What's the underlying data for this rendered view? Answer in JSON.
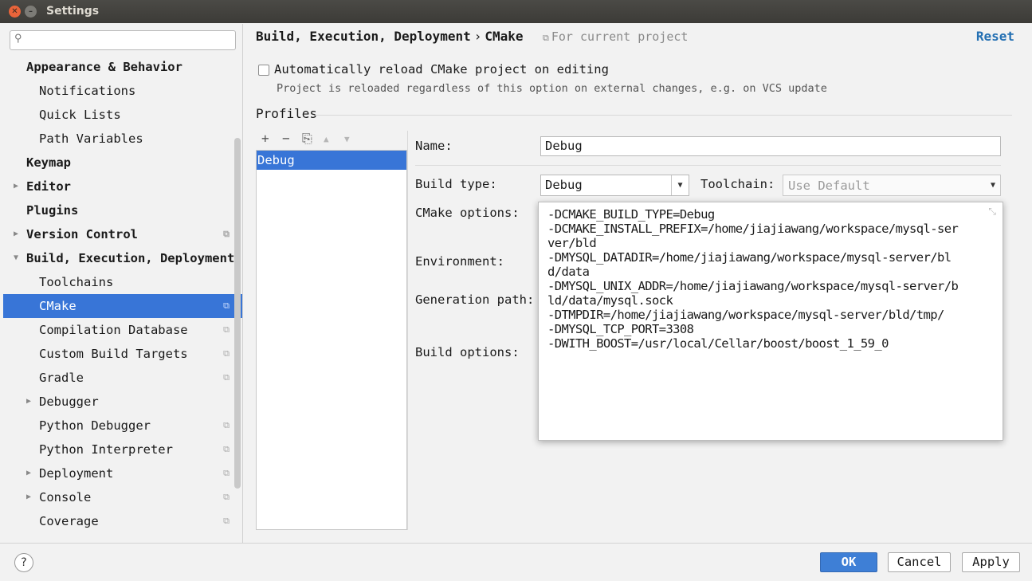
{
  "window": {
    "title": "Settings"
  },
  "sidebar": {
    "search_placeholder": "",
    "items": [
      {
        "label": "Appearance & Behavior",
        "level": 0,
        "arrow": "",
        "copy": false
      },
      {
        "label": "Notifications",
        "level": 1,
        "arrow": "",
        "copy": false
      },
      {
        "label": "Quick Lists",
        "level": 1,
        "arrow": "",
        "copy": false
      },
      {
        "label": "Path Variables",
        "level": 1,
        "arrow": "",
        "copy": false
      },
      {
        "label": "Keymap",
        "level": 0,
        "arrow": "",
        "copy": false
      },
      {
        "label": "Editor",
        "level": 0,
        "arrow": "▶",
        "copy": false
      },
      {
        "label": "Plugins",
        "level": 0,
        "arrow": "",
        "copy": false
      },
      {
        "label": "Version Control",
        "level": 0,
        "arrow": "▶",
        "copy": true
      },
      {
        "label": "Build, Execution, Deployment",
        "level": 0,
        "arrow": "▼",
        "copy": false
      },
      {
        "label": "Toolchains",
        "level": 1,
        "arrow": "",
        "copy": false
      },
      {
        "label": "CMake",
        "level": 1,
        "arrow": "",
        "copy": true,
        "selected": true
      },
      {
        "label": "Compilation Database",
        "level": 1,
        "arrow": "",
        "copy": true
      },
      {
        "label": "Custom Build Targets",
        "level": 1,
        "arrow": "",
        "copy": true
      },
      {
        "label": "Gradle",
        "level": 1,
        "arrow": "",
        "copy": true
      },
      {
        "label": "Debugger",
        "level": 1,
        "arrow": "▶",
        "copy": false
      },
      {
        "label": "Python Debugger",
        "level": 1,
        "arrow": "",
        "copy": true
      },
      {
        "label": "Python Interpreter",
        "level": 1,
        "arrow": "",
        "copy": true
      },
      {
        "label": "Deployment",
        "level": 1,
        "arrow": "▶",
        "copy": true
      },
      {
        "label": "Console",
        "level": 1,
        "arrow": "▶",
        "copy": true
      },
      {
        "label": "Coverage",
        "level": 1,
        "arrow": "",
        "copy": true
      }
    ]
  },
  "header": {
    "breadcrumb_parent": "Build, Execution, Deployment",
    "breadcrumb_sep": "›",
    "breadcrumb_current": "CMake",
    "for_project": "For current project",
    "reset": "Reset"
  },
  "options": {
    "auto_reload_label": "Automatically reload CMake project on editing",
    "auto_reload_checked": false,
    "auto_reload_hint": "Project is reloaded regardless of this option on external changes, e.g. on VCS update"
  },
  "profiles": {
    "title": "Profiles",
    "toolbar": {
      "add": "+",
      "remove": "−",
      "copy": "⎘",
      "up": "▲",
      "down": "▼"
    },
    "list": [
      "Debug"
    ],
    "labels": {
      "name": "Name:",
      "build_type": "Build type:",
      "toolchain": "Toolchain:",
      "cmake_options": "CMake options:",
      "environment": "Environment:",
      "generation_path": "Generation path:",
      "build_options": "Build options:"
    },
    "name_value": "Debug",
    "build_type_value": "Debug",
    "toolchain_value": "Use Default",
    "cmake_options_text": "-DCMAKE_BUILD_TYPE=Debug\n-DCMAKE_INSTALL_PREFIX=/home/jiajiawang/workspace/mysql-server/bld\n-DMYSQL_DATADIR=/home/jiajiawang/workspace/mysql-server/bld/data\n-DMYSQL_UNIX_ADDR=/home/jiajiawang/workspace/mysql-server/bld/data/mysql.sock\n-DTMPDIR=/home/jiajiawang/workspace/mysql-server/bld/tmp/\n-DMYSQL_TCP_PORT=3308\n-DWITH_BOOST=/usr/local/Cellar/boost/boost_1_59_0"
  },
  "footer": {
    "help": "?",
    "ok": "OK",
    "cancel": "Cancel",
    "apply": "Apply"
  }
}
